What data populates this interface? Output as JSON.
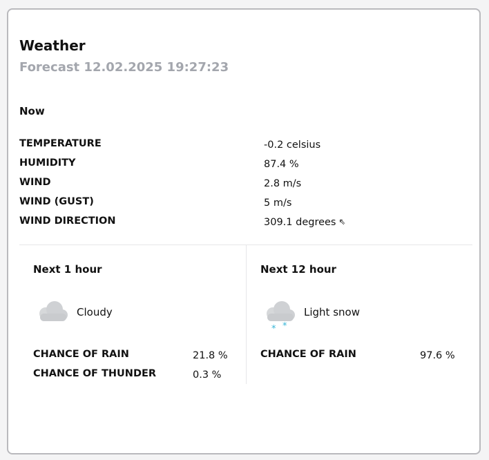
{
  "card": {
    "title": "Weather",
    "subtitle": "Forecast 12.02.2025 19:27:23"
  },
  "now": {
    "heading": "Now",
    "rows": [
      {
        "label": "TEMPERATURE",
        "value": "-0.2 celsius"
      },
      {
        "label": "HUMIDITY",
        "value": "87.4 %"
      },
      {
        "label": "WIND",
        "value": "2.8 m/s"
      },
      {
        "label": "WIND (GUST)",
        "value": "5 m/s"
      },
      {
        "label": "WIND DIRECTION",
        "value": "309.1 degrees"
      }
    ],
    "wind_direction_icon": "arrow-up-left-icon",
    "wind_direction_glyph": "⇖"
  },
  "next1": {
    "heading": "Next 1 hour",
    "condition": "Cloudy",
    "icon": "cloudy-icon",
    "rows": [
      {
        "label": "CHANCE OF RAIN",
        "value": "21.8 %"
      },
      {
        "label": "CHANCE OF THUNDER",
        "value": "0.3 %"
      }
    ]
  },
  "next12": {
    "heading": "Next 12 hour",
    "condition": "Light snow",
    "icon": "light-snow-icon",
    "rows": [
      {
        "label": "CHANCE OF RAIN",
        "value": "97.6 %"
      }
    ]
  },
  "colors": {
    "subtitle": "#a3a6ad",
    "cloud": "#c9cbce",
    "snow": "#38b6d8",
    "border": "#b9b9bd"
  }
}
